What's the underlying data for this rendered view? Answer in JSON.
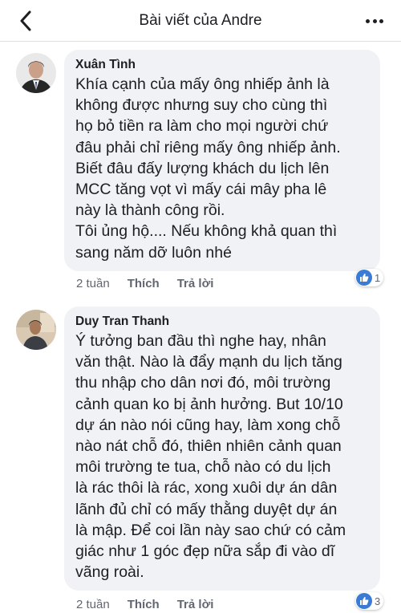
{
  "header": {
    "title": "Bài viết của Andre"
  },
  "comments": [
    {
      "author": "Xuân Tình",
      "text": "Khía cạnh của mấy ông nhiếp ảnh là\nkhông được nhưng suy cho cùng thì\nhọ bỏ tiền ra làm cho mọi người chứ\nđâu phải chỉ riêng mấy ông nhiếp ảnh.\nBiết đâu đấy lượng khách du lịch lên\nMCC tăng vọt vì mấy cái mây pha lê\nnày là thành công rồi.\nTôi ủng hộ.... Nếu không khả quan thì\nsang năm dỡ luôn nhé",
      "time": "2 tuần",
      "like_label": "Thích",
      "reply_label": "Trả lời",
      "reaction_count": "1",
      "reaction_icon": "like-icon"
    },
    {
      "author": "Duy Tran Thanh",
      "text": "Ý tưởng ban đầu thì nghe hay, nhân\nvăn thật. Nào là đẩy mạnh du lịch tăng\nthu nhập cho dân nơi đó, môi trường\ncảnh quan ko bị ảnh hưởng. But 10/10\ndự án nào nói cũng hay, làm xong chỗ\nnào nát chỗ đó, thiên nhiên cảnh quan\nmôi trường te tua, chỗ nào có du lịch\nlà rác thôi là rác, xong xuôi dự án dân\nlãnh đủ chỉ có mấy thằng duyệt dự án\nlà mập. Để coi lần này sao chứ có cảm\ngiác như 1 góc đẹp nữa sắp đi vào dĩ\nvãng roài.",
      "time": "2 tuần",
      "like_label": "Thích",
      "reply_label": "Trả lời",
      "reaction_count": "3",
      "reaction_icon": "like-icon"
    }
  ]
}
